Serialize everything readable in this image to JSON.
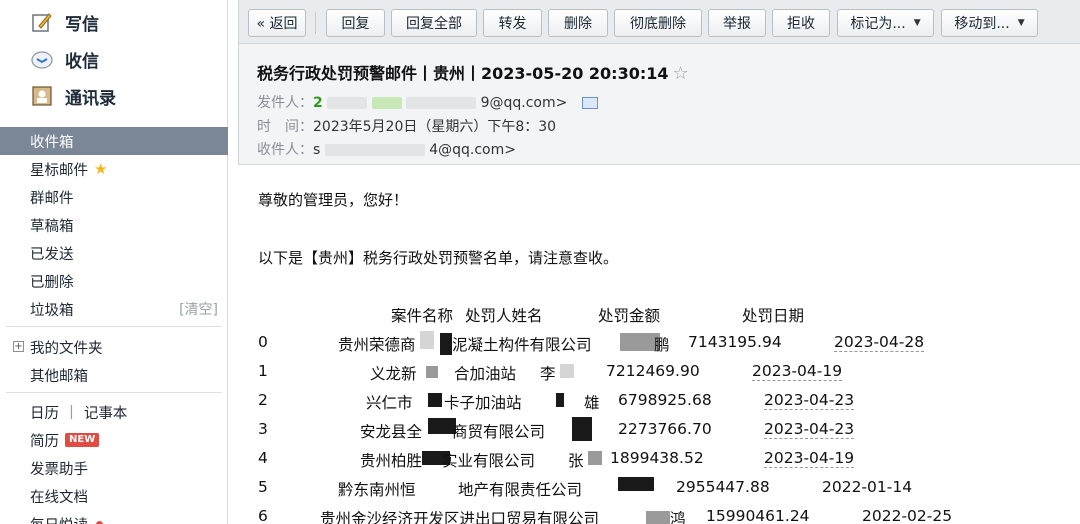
{
  "sidebar": {
    "compose": "写信",
    "inbox_check": "收信",
    "contacts": "通讯录",
    "folders": [
      {
        "label": "收件箱"
      },
      {
        "label": "星标邮件"
      },
      {
        "label": "群邮件"
      },
      {
        "label": "草稿箱"
      },
      {
        "label": "已发送"
      },
      {
        "label": "已删除"
      },
      {
        "label": "垃圾箱",
        "extra": "[清空]"
      }
    ],
    "my_folders": "我的文件夹",
    "other_mail": "其他邮箱",
    "calendar": "日历",
    "notebook": "记事本",
    "resume": "简历",
    "resume_badge": "NEW",
    "invoice": "发票助手",
    "online_docs": "在线文档",
    "daily_read": "每日悦读"
  },
  "toolbar": {
    "back": "« 返回",
    "reply": "回复",
    "reply_all": "回复全部",
    "forward": "转发",
    "delete": "删除",
    "delete_perm": "彻底删除",
    "report": "举报",
    "reject": "拒收",
    "mark_as": "标记为...",
    "move_to": "移动到..."
  },
  "email": {
    "subject": "税务行政处罚预警邮件丨贵州丨2023-05-20 20:30:14",
    "from_label": "发件人：",
    "from_prefix": "2",
    "from_suffix": "9@qq.com>",
    "time_label": "时　间：",
    "time_value": "2023年5月20日（星期六）下午8：30",
    "to_label": "收件人：",
    "to_prefix": "s",
    "to_suffix": "4@qq.com>",
    "greeting": "尊敬的管理员，您好！",
    "intro": "以下是【贵州】税务行政处罚预警名单，请注意查收。"
  },
  "table": {
    "headers": [
      "案件名称",
      "处罚人姓名",
      "处罚金额",
      "处罚日期"
    ],
    "rows": [
      {
        "idx": "0",
        "name_a": "贵州荣德商",
        "name_b": "泥凝土构件有限公司",
        "person": "鹏",
        "amount": "7143195.94",
        "date": "2023-04-28"
      },
      {
        "idx": "1",
        "name_a": "义龙新",
        "name_b": "合加油站",
        "person": "李",
        "amount": "7212469.90",
        "date": "2023-04-19"
      },
      {
        "idx": "2",
        "name_a": "兴仁市",
        "name_b": "卡子加油站",
        "person": "雄",
        "amount": "6798925.68",
        "date": "2023-04-23"
      },
      {
        "idx": "3",
        "name_a": "安龙县全",
        "name_b": "商贸有限公司",
        "person": "",
        "amount": "2273766.70",
        "date": "2023-04-23"
      },
      {
        "idx": "4",
        "name_a": "贵州柏胜",
        "name_b": "实业有限公司",
        "person": "张",
        "amount": "1899438.52",
        "date": "2023-04-19"
      },
      {
        "idx": "5",
        "name_a": "黔东南州恒",
        "name_b": "地产有限责任公司",
        "person": "",
        "amount": "2955447.88",
        "date": "2022-01-14"
      },
      {
        "idx": "6",
        "name_a": "贵州金沙经济开发区进出口贸易有限公司",
        "name_b": "",
        "person": "鸿",
        "amount": "15990461.24",
        "date": "2022-02-25"
      }
    ]
  },
  "colors": {
    "sidebar_active": "#7b8796",
    "toolbar_bg": "#e9ecef",
    "header_bg": "#f3f4f6",
    "badge_red": "#e14b43",
    "star_yellow": "#f3b81b"
  }
}
